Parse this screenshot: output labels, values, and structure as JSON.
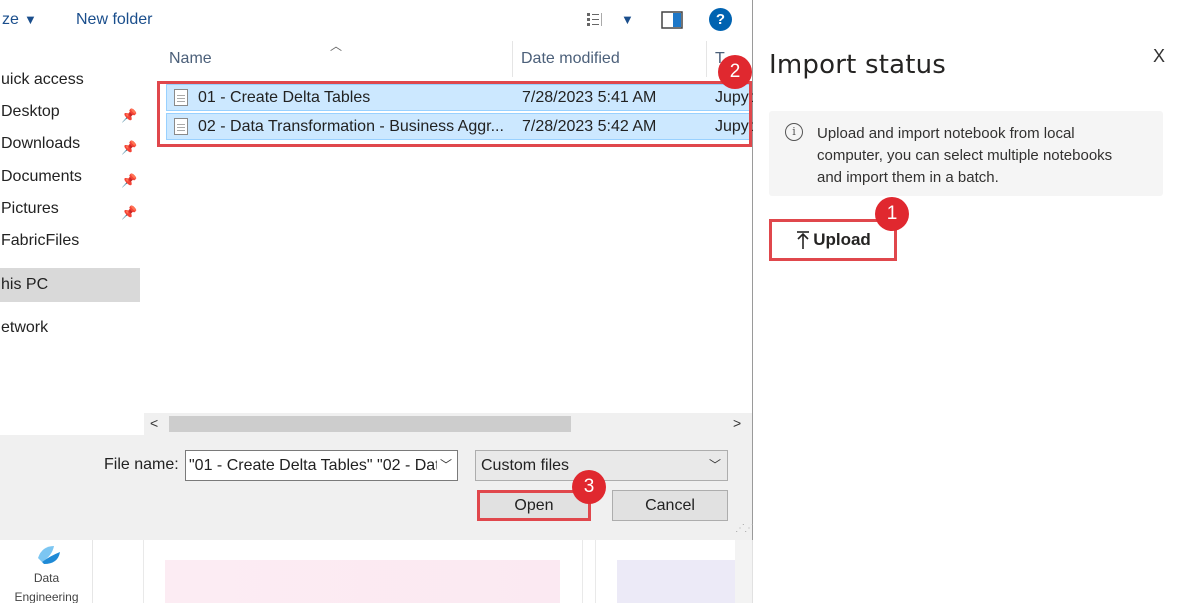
{
  "background_app": {
    "tile_label_line1": "Data",
    "tile_label_line2": "Engineering"
  },
  "import_panel": {
    "title": "Import status",
    "close_label": "X",
    "info_text": "Upload and import notebook from local computer, you can select multiple notebooks and import them in a batch.",
    "info_icon": "i",
    "upload_icon": "upload-icon",
    "upload_label": "Upload"
  },
  "callouts": {
    "one": "1",
    "two": "2",
    "three": "3"
  },
  "dialog": {
    "toolbar": {
      "organize_label": "ze",
      "new_folder_label": "New folder",
      "help_label": "?"
    },
    "nav": {
      "items": [
        {
          "label": "uick access",
          "pinned": false
        },
        {
          "label": "Desktop",
          "pinned": true
        },
        {
          "label": "Downloads",
          "pinned": true
        },
        {
          "label": "Documents",
          "pinned": true
        },
        {
          "label": "Pictures",
          "pinned": true
        },
        {
          "label": "FabricFiles",
          "pinned": false
        },
        {
          "label": "his PC",
          "pinned": false,
          "selected": true
        },
        {
          "label": "etwork",
          "pinned": false
        }
      ]
    },
    "columns": {
      "name": "Name",
      "date_modified": "Date modified",
      "type": "T"
    },
    "files": [
      {
        "name": "01 - Create Delta Tables",
        "date": "7/28/2023 5:41 AM",
        "type": "Jupyt",
        "selected": true
      },
      {
        "name": "02 - Data Transformation - Business Aggr...",
        "date": "7/28/2023 5:42 AM",
        "type": "Jupyt",
        "selected": true
      }
    ],
    "file_name_label": "File name:",
    "file_name_value": "\"01 - Create Delta Tables\" \"02 - Dat",
    "file_type_value": "Custom files",
    "open_label": "Open",
    "cancel_label": "Cancel"
  },
  "colors": {
    "highlight_red": "#e0474c",
    "callout_red": "#e0282f",
    "selection_blue": "#cce8ff",
    "link_blue": "#1a4e8c"
  }
}
